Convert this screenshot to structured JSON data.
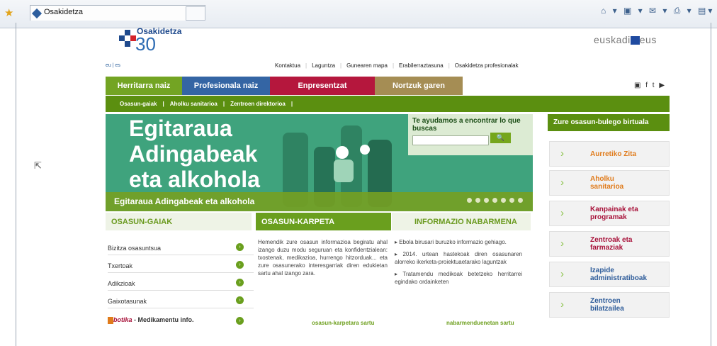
{
  "browser": {
    "tab_title": "Osakidetza",
    "toolbar_icons": "⌂ ▾ ▣ ▾ ✉ ▾ ⎙ ▾ ▤▾"
  },
  "site": {
    "logo_text": "Osakidetza",
    "logo_number": "30",
    "euskadi": "euskadi",
    "euskadi_suffix": "eus",
    "languages": "eu | es",
    "top_links": [
      "Kontaktua",
      "Laguntza",
      "Gunearen mapa",
      "Erabilerraztasuna",
      "Osakidetza profesionalak"
    ],
    "nav": [
      {
        "label": "Herritarra naiz",
        "color": "#73a423"
      },
      {
        "label": "Profesionala naiz",
        "color": "#3465a4"
      },
      {
        "label": "Enpresentzat",
        "color": "#b5173d"
      },
      {
        "label": "Nortzuk garen",
        "color": "#a58d54"
      }
    ],
    "subnav": [
      "Osasun-gaiak",
      "Aholku sanitarioa",
      "Zentroen direktorioa"
    ],
    "social": "▣ f t ▶"
  },
  "hero": {
    "line1": "Egitaraua",
    "line2": "Adingabeak",
    "line3": "eta alkohola",
    "caption": "Egitaraua Adingabeak eta alkohola",
    "dots": 7
  },
  "search": {
    "title": "Te ayudamos a encontrar lo que buscas",
    "button": "🔍"
  },
  "sidebar": {
    "title": "Zure osasun-bulego birtuala",
    "cards": [
      {
        "label": "Aurretiko Zita",
        "color": "#e07b1b"
      },
      {
        "label": "Aholku sanitarioa",
        "color": "#e07b1b"
      },
      {
        "label": "Kanpainak eta programak",
        "color": "#a8123a"
      },
      {
        "label": "Zentroak eta farmaziak",
        "color": "#a8123a"
      },
      {
        "label": "Izapide administratiboak",
        "color": "#2e5c9a"
      },
      {
        "label": "Zentroen bilatzailea",
        "color": "#2e5c9a"
      }
    ]
  },
  "columns": {
    "gaiak_title": "OSASUN-GAIAK",
    "gaiak_items": [
      "Bizitza osasuntsua",
      "Txertoak",
      "Adikzioak",
      "Gaixotasunak"
    ],
    "botika_prefix": "botika",
    "botika_suffix": " - Medikamentu info.",
    "karpeta_title": "OSASUN-KARPETA",
    "karpeta_text": "Hemendik zure osasun informazioa begiratu ahal izango duzu modu seguruan eta konfidentzialean: txostenak, medikazioa, hurrengo hitzorduak... eta zure osasunerako interesgarriak diren edukietan sartu ahal izango zara.",
    "karpeta_more": "osasun-karpetara sartu",
    "info_title": "INFORMAZIO NABARMENA",
    "info_items": [
      "▸ Ebola birusari buruzko informazio gehiago.",
      "▸ 2014. urtean hastekoak diren osasunaren alorreko ikerketa-proiektuaetarako laguntzak",
      "▸ Tratamendu medikoak betetzeko herritarrei egindako ordainketen"
    ],
    "info_more": "nabarmenduenetan sartu"
  }
}
